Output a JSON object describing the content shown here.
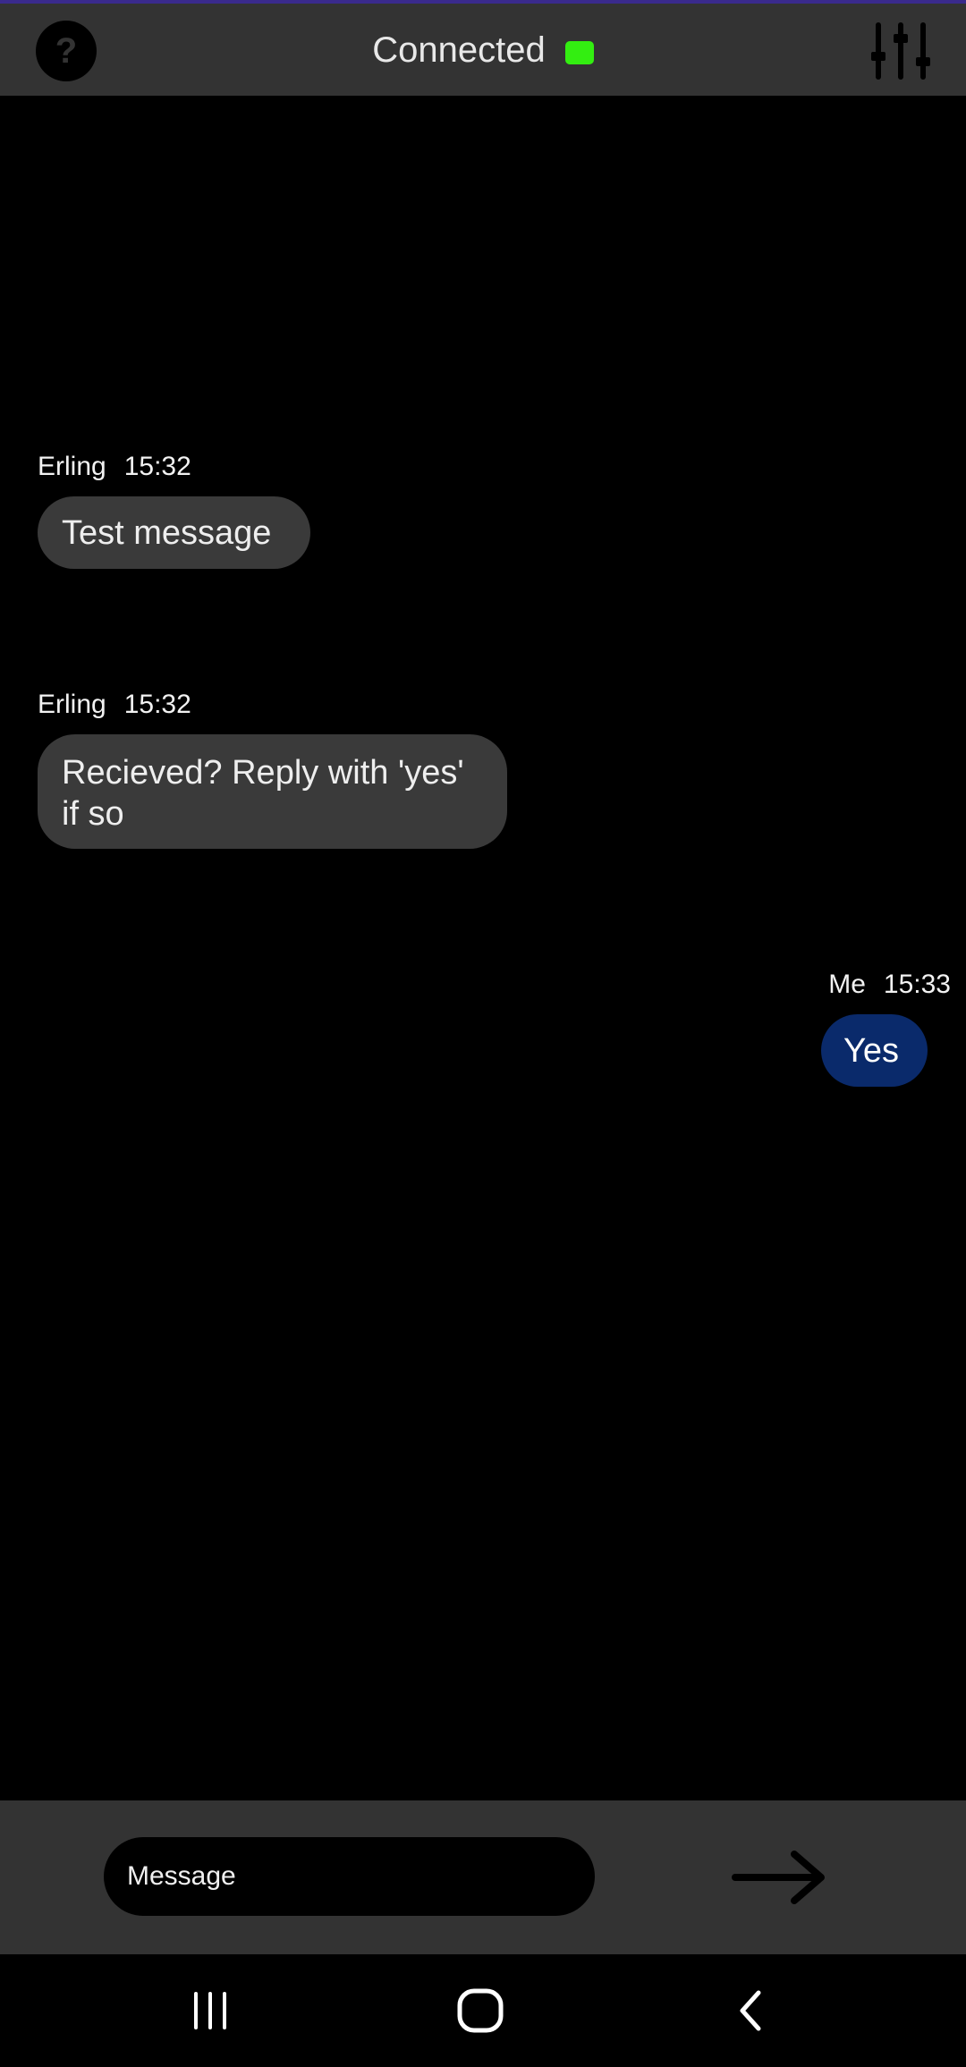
{
  "header": {
    "status_text": "Connected",
    "status_color": "#33ee11",
    "help_icon": "help-icon",
    "settings_icon": "sliders-icon"
  },
  "messages": [
    {
      "sender": "Erling",
      "time": "15:32",
      "text": "Test message",
      "from_me": false
    },
    {
      "sender": "Erling",
      "time": "15:32",
      "text": "Recieved? Reply with 'yes' if so",
      "from_me": false
    },
    {
      "sender": "Me",
      "time": "15:33",
      "text": "Yes",
      "from_me": true
    }
  ],
  "composer": {
    "placeholder": "Message",
    "value": "",
    "send_icon": "arrow-right-icon"
  },
  "navbar": {
    "recents_icon": "recents-icon",
    "home_icon": "home-icon",
    "back_icon": "back-icon"
  },
  "colors": {
    "background": "#000000",
    "bar": "#333333",
    "incoming_bubble": "#3a3a3a",
    "outgoing_bubble": "#0a2a6b"
  }
}
